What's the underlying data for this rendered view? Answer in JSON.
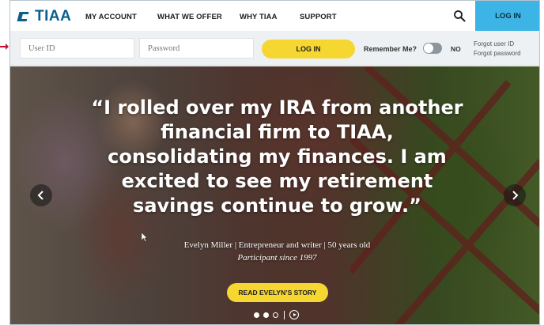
{
  "brand": {
    "name": "TIAA",
    "color": "#0a5f8c"
  },
  "nav": {
    "items": [
      "MY ACCOUNT",
      "WHAT WE OFFER",
      "WHY TIAA",
      "SUPPORT"
    ],
    "search_icon": "search-icon",
    "login_label": "LOG IN",
    "login_color": "#3cb4e5"
  },
  "login_bar": {
    "user_id_placeholder": "User ID",
    "password_placeholder": "Password",
    "login_button": "LOG IN",
    "remember_label": "Remember Me?",
    "remember_state": "NO",
    "forgot_user_id": "Forgot user ID",
    "forgot_password": "Forgot password",
    "button_color": "#f6d630"
  },
  "hero": {
    "quote": "“I rolled over my IRA from another financial firm to TIAA, consolidating my finances. I am excited to see my retirement savings continue to grow.”",
    "attribution": "Evelyn Miller | Entrepreneur and writer | 50 years old",
    "participant_since": "Participant since 1997",
    "cta": "READ EVELYN’S STORY",
    "prev_icon": "chevron-left-icon",
    "next_icon": "chevron-right-icon",
    "slides_total": 3,
    "slide_active": 2,
    "play_icon": "play-icon"
  }
}
